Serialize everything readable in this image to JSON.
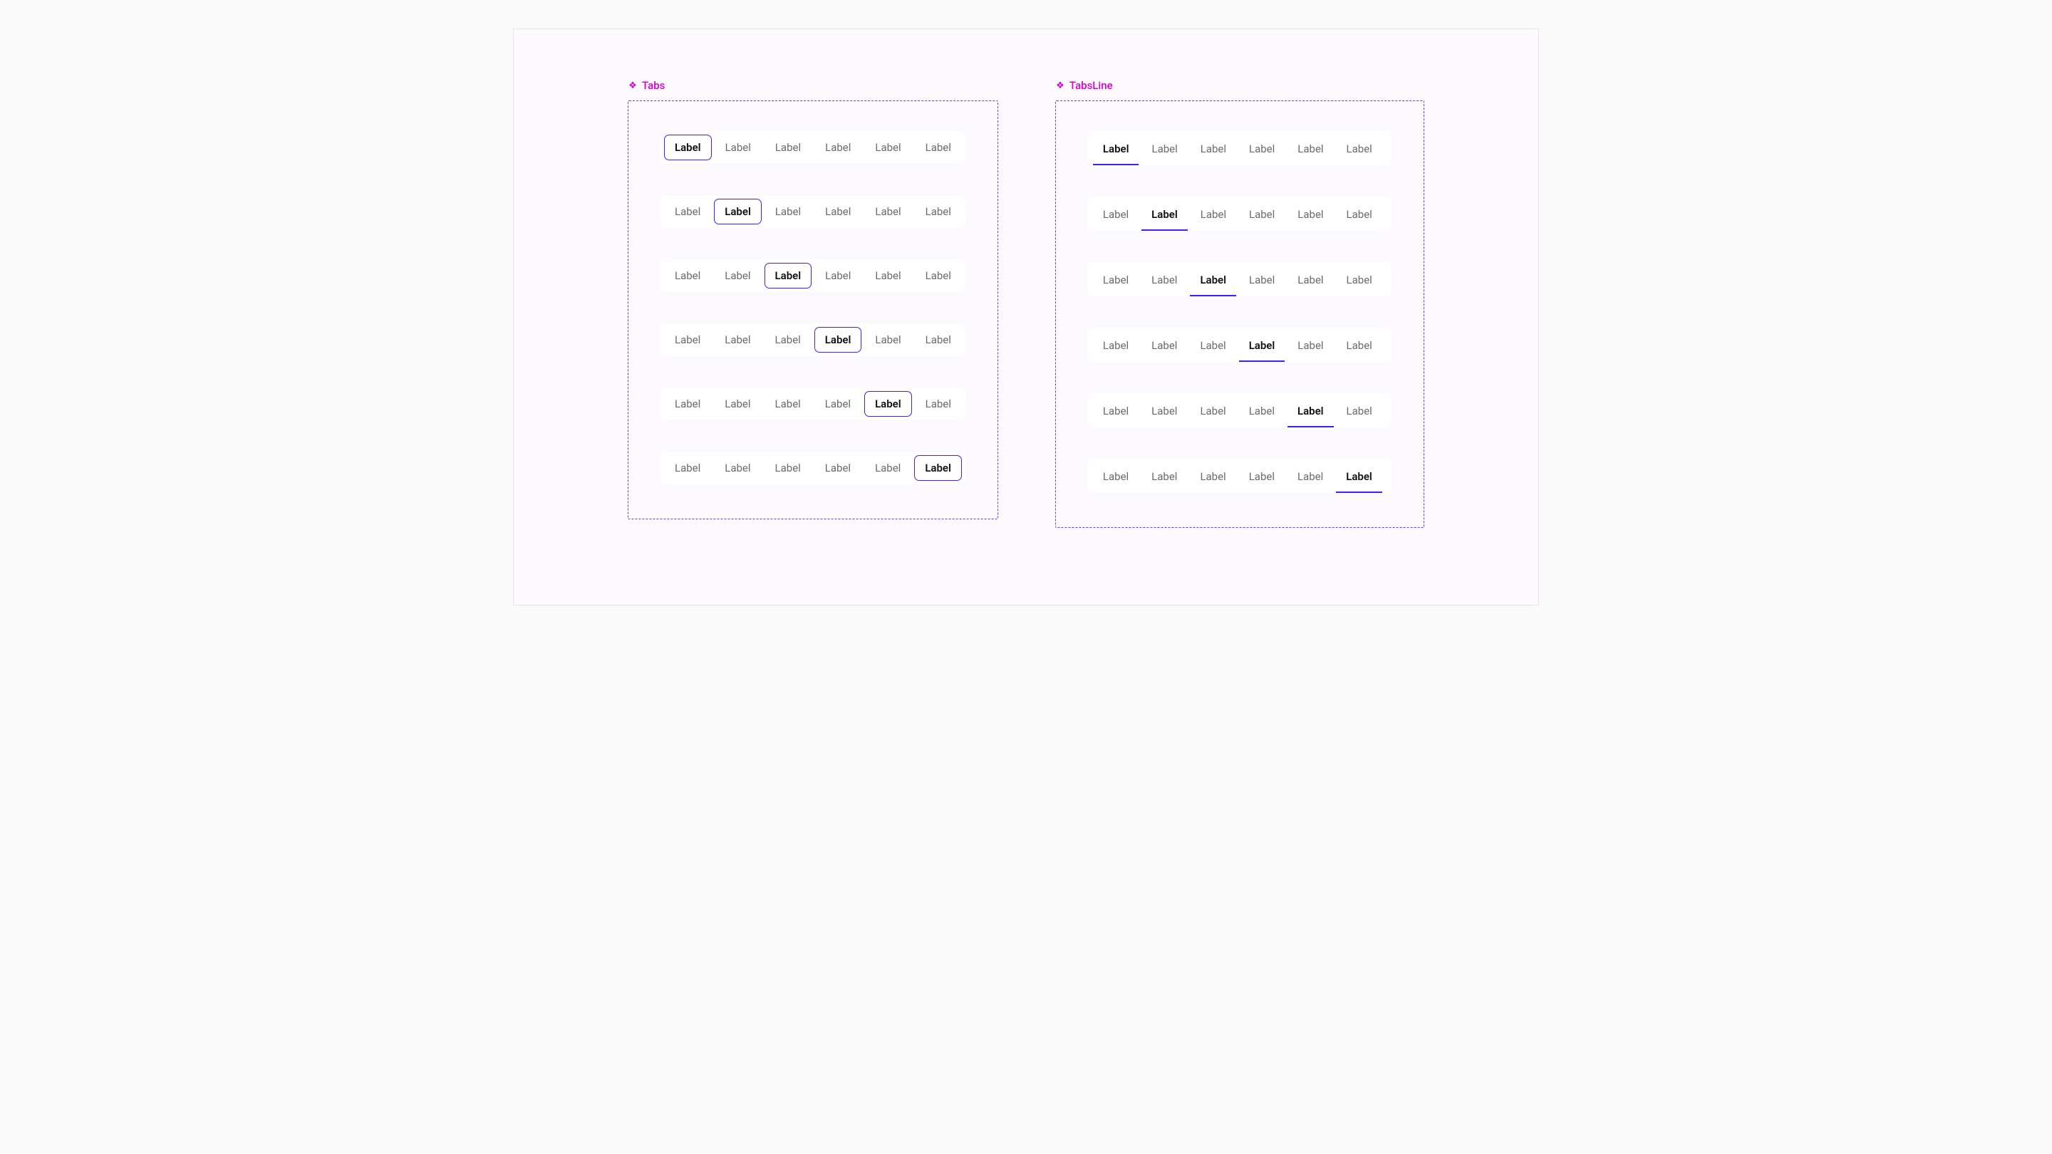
{
  "colors": {
    "accent": "#3f1fff",
    "component_label": "#d400d4",
    "tab_inactive_text": "#6b6b6b",
    "tab_active_text": "#111111",
    "panel_bg": "#fcfaff",
    "row_bg": "#ffffff"
  },
  "icons": {
    "component_glyph": "❖"
  },
  "left": {
    "title": "Tabs",
    "rows": [
      {
        "active_index": 0,
        "items": [
          "Label",
          "Label",
          "Label",
          "Label",
          "Label",
          "Label"
        ]
      },
      {
        "active_index": 1,
        "items": [
          "Label",
          "Label",
          "Label",
          "Label",
          "Label",
          "Label"
        ]
      },
      {
        "active_index": 2,
        "items": [
          "Label",
          "Label",
          "Label",
          "Label",
          "Label",
          "Label"
        ]
      },
      {
        "active_index": 3,
        "items": [
          "Label",
          "Label",
          "Label",
          "Label",
          "Label",
          "Label"
        ]
      },
      {
        "active_index": 4,
        "items": [
          "Label",
          "Label",
          "Label",
          "Label",
          "Label",
          "Label"
        ]
      },
      {
        "active_index": 5,
        "items": [
          "Label",
          "Label",
          "Label",
          "Label",
          "Label",
          "Label"
        ]
      }
    ]
  },
  "right": {
    "title": "TabsLine",
    "rows": [
      {
        "active_index": 0,
        "items": [
          "Label",
          "Label",
          "Label",
          "Label",
          "Label",
          "Label"
        ]
      },
      {
        "active_index": 1,
        "items": [
          "Label",
          "Label",
          "Label",
          "Label",
          "Label",
          "Label"
        ]
      },
      {
        "active_index": 2,
        "items": [
          "Label",
          "Label",
          "Label",
          "Label",
          "Label",
          "Label"
        ]
      },
      {
        "active_index": 3,
        "items": [
          "Label",
          "Label",
          "Label",
          "Label",
          "Label",
          "Label"
        ]
      },
      {
        "active_index": 4,
        "items": [
          "Label",
          "Label",
          "Label",
          "Label",
          "Label",
          "Label"
        ]
      },
      {
        "active_index": 5,
        "items": [
          "Label",
          "Label",
          "Label",
          "Label",
          "Label",
          "Label"
        ]
      }
    ]
  }
}
